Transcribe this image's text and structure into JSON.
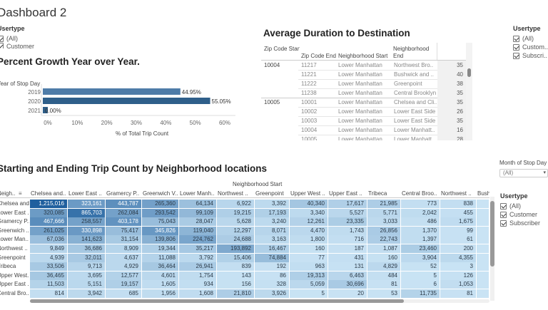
{
  "dashboard": {
    "title": "Dashboard 2"
  },
  "left_filter": {
    "title": "Usertype",
    "options": [
      {
        "label": "(All)",
        "checked": true
      },
      {
        "label": "Customer",
        "checked": true
      }
    ]
  },
  "right_filter_top": {
    "title": "Usertype",
    "options": [
      {
        "label": "(All)",
        "checked": true
      },
      {
        "label": "Custom..",
        "checked": true
      },
      {
        "label": "Subscri..",
        "checked": true
      }
    ]
  },
  "month_filter": {
    "title": "Month of Stop Day",
    "value": "(All)"
  },
  "right_filter_bottom": {
    "title": "Usertype",
    "options": [
      {
        "label": "(All)",
        "checked": true
      },
      {
        "label": "Customer",
        "checked": true
      },
      {
        "label": "Subscriber",
        "checked": true
      }
    ]
  },
  "growth_chart": {
    "title": "Percent Growth Year over Year.",
    "ylabel": "Year of Stop Day",
    "xlabel": "% of Total Trip Count",
    "x_ticks": [
      "0%",
      "10%",
      "20%",
      "30%",
      "40%",
      "50%",
      "60%"
    ],
    "colors": {
      "bar_2019": "#4e7ca8",
      "bar_2020": "#2f5f8a"
    }
  },
  "chart_data": [
    {
      "type": "bar",
      "orientation": "horizontal",
      "title": "Percent Growth Year over Year.",
      "categories": [
        "2019",
        "2020",
        "2021"
      ],
      "values": [
        44.95,
        55.05,
        0.0
      ],
      "labels": [
        "44.95%",
        "55.05%",
        "0.00%"
      ],
      "xlabel": "% of Total Trip Count",
      "ylabel": "Year of Stop Day",
      "xlim": [
        0,
        60
      ]
    },
    {
      "type": "heatmap",
      "title": "Starting and Ending Trip Count by Neighborhood locations",
      "column_group_label": "Neighborhood Start",
      "row_header": "Neigh..",
      "columns": [
        "Chelsea and..",
        "Lower East ..",
        "Gramercy P..",
        "Greenwich V..",
        "Lower Manh..",
        "Northwest ..",
        "Greenpoint",
        "Upper West ..",
        "Upper East ..",
        "Tribeca",
        "Central Broo..",
        "Northwest ..",
        "Bush"
      ],
      "rows": [
        "Chelsea and..",
        "Lower East ..",
        "Gramercy P..",
        "Greenwich ..",
        "Lower Man..",
        "Northwest ..",
        "Greenpoint",
        "Tribeca",
        "Upper West..",
        "Upper East ..",
        "Central Bro.."
      ],
      "values": [
        [
          1215016,
          323161,
          443787,
          265360,
          64134,
          6922,
          3392,
          40340,
          17617,
          21985,
          773,
          838,
          null
        ],
        [
          320085,
          865703,
          262084,
          293542,
          99109,
          19215,
          17193,
          3340,
          5527,
          5771,
          2042,
          455,
          null
        ],
        [
          467666,
          258557,
          403178,
          75043,
          28047,
          5628,
          3240,
          12261,
          23335,
          3033,
          486,
          1675,
          null
        ],
        [
          261025,
          330898,
          75417,
          345826,
          119040,
          12297,
          8071,
          4470,
          1743,
          26856,
          1370,
          99,
          null
        ],
        [
          67036,
          141623,
          31154,
          139806,
          224762,
          24688,
          3163,
          1800,
          716,
          22743,
          1397,
          61,
          null
        ],
        [
          9849,
          36686,
          8909,
          19344,
          35217,
          193892,
          16467,
          160,
          187,
          1087,
          23460,
          200,
          null
        ],
        [
          4939,
          32011,
          4637,
          11088,
          3792,
          15406,
          74884,
          77,
          431,
          160,
          3904,
          4355,
          null
        ],
        [
          33506,
          9713,
          4929,
          36464,
          26941,
          839,
          192,
          963,
          131,
          4829,
          52,
          3,
          null
        ],
        [
          36465,
          3695,
          12577,
          4601,
          1754,
          143,
          86,
          19313,
          6463,
          484,
          5,
          126,
          null
        ],
        [
          11503,
          5151,
          19157,
          1605,
          934,
          156,
          328,
          5059,
          30696,
          81,
          6,
          1053,
          null
        ],
        [
          814,
          3942,
          685,
          1956,
          1608,
          21810,
          3926,
          5,
          20,
          53,
          11735,
          81,
          null
        ]
      ],
      "display": [
        [
          "1,215,016",
          "323,161",
          "443,787",
          "265,360",
          "64,134",
          "6,922",
          "3,392",
          "40,340",
          "17,617",
          "21,985",
          "773",
          "838",
          ""
        ],
        [
          "320,085",
          "865,703",
          "262,084",
          "293,542",
          "99,109",
          "19,215",
          "17,193",
          "3,340",
          "5,527",
          "5,771",
          "2,042",
          "455",
          ""
        ],
        [
          "467,666",
          "258,557",
          "403,178",
          "75,043",
          "28,047",
          "5,628",
          "3,240",
          "12,261",
          "23,335",
          "3,033",
          "486",
          "1,675",
          ""
        ],
        [
          "261,025",
          "330,898",
          "75,417",
          "345,826",
          "119,040",
          "12,297",
          "8,071",
          "4,470",
          "1,743",
          "26,856",
          "1,370",
          "99",
          ""
        ],
        [
          "67,036",
          "141,623",
          "31,154",
          "139,806",
          "224,762",
          "24,688",
          "3,163",
          "1,800",
          "716",
          "22,743",
          "1,397",
          "61",
          ""
        ],
        [
          "9,849",
          "36,686",
          "8,909",
          "19,344",
          "35,217",
          "193,892",
          "16,467",
          "160",
          "187",
          "1,087",
          "23,460",
          "200",
          ""
        ],
        [
          "4,939",
          "32,011",
          "4,637",
          "11,088",
          "3,792",
          "15,406",
          "74,884",
          "77",
          "431",
          "160",
          "3,904",
          "4,355",
          ""
        ],
        [
          "33,506",
          "9,713",
          "4,929",
          "36,464",
          "26,941",
          "839",
          "192",
          "963",
          "131",
          "4,829",
          "52",
          "3",
          ""
        ],
        [
          "36,465",
          "3,695",
          "12,577",
          "4,601",
          "1,754",
          "143",
          "86",
          "19,313",
          "6,463",
          "484",
          "5",
          "126",
          ""
        ],
        [
          "11,503",
          "5,151",
          "19,157",
          "1,605",
          "934",
          "156",
          "328",
          "5,059",
          "30,696",
          "81",
          "6",
          "1,053",
          ""
        ],
        [
          "814",
          "3,942",
          "685",
          "1,956",
          "1,608",
          "21,810",
          "3,926",
          "5",
          "20",
          "53",
          "11,735",
          "81",
          ""
        ]
      ],
      "colors": {
        "low": "#c9e3f4",
        "high": "#1f5f9e"
      }
    }
  ],
  "duration_table": {
    "title": "Average Duration to Destination",
    "headers": [
      "Zip Code Start",
      "Zip Code End",
      "Neighborhood Start",
      "Neighborhood End"
    ],
    "groups": [
      {
        "zip_start": "10004",
        "rows": [
          {
            "zip_end": "11217",
            "start": "Lower Manhattan",
            "end": "Northwest Bro..",
            "value": "35"
          },
          {
            "zip_end": "11221",
            "start": "Lower Manhattan",
            "end": "Bushwick and ..",
            "value": "40"
          },
          {
            "zip_end": "11222",
            "start": "Lower Manhattan",
            "end": "Greenpoint",
            "value": "38"
          },
          {
            "zip_end": "11238",
            "start": "Lower Manhattan",
            "end": "Central Brooklyn",
            "value": "35"
          }
        ]
      },
      {
        "zip_start": "10005",
        "rows": [
          {
            "zip_end": "10001",
            "start": "Lower Manhattan",
            "end": "Chelsea and Cli..",
            "value": "35"
          },
          {
            "zip_end": "10002",
            "start": "Lower Manhattan",
            "end": "Lower East Side",
            "value": "26"
          },
          {
            "zip_end": "10003",
            "start": "Lower Manhattan",
            "end": "Lower East Side",
            "value": "35"
          },
          {
            "zip_end": "10004",
            "start": "Lower Manhattan",
            "end": "Lower Manhatt..",
            "value": "16"
          },
          {
            "zip_end": "10005",
            "start": "Lower Manhattan",
            "end": "Lower Manhatt..",
            "value": "28"
          }
        ]
      }
    ]
  }
}
